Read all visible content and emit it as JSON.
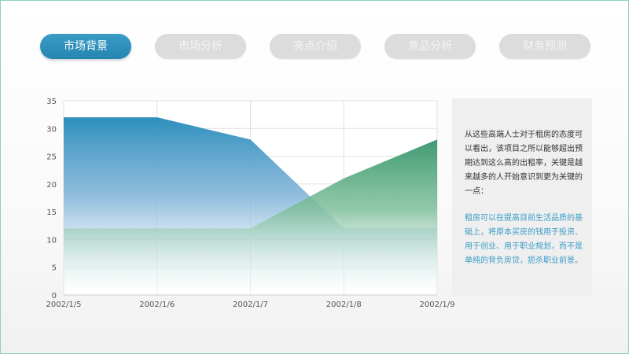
{
  "tabs": [
    {
      "label": "市场背景",
      "active": true
    },
    {
      "label": "市场分析",
      "active": false
    },
    {
      "label": "亮点介绍",
      "active": false
    },
    {
      "label": "竞品分析",
      "active": false
    },
    {
      "label": "财务预测",
      "active": false
    }
  ],
  "panel": {
    "paragraph1": "从这些高端人士对于租房的态度可以看出，该项目之所以能够超出预期达到这么高的出租率，关键是越来越多的人开始意识到更为关键的一点：",
    "paragraph2": "租房可以在提高目前生活品质的基础上，将原本买房的钱用于投资、用于创业、用于职业规划，而不是单纯的背负房贷，扼杀职业前景。"
  },
  "colors": {
    "accent": "#2e8fbd",
    "series1": "#2e8fbd",
    "series2": "#3f9a72",
    "panel_text_highlight": "#3a9cc6"
  },
  "chart_data": {
    "type": "area",
    "x": [
      "2002/1/5",
      "2002/1/6",
      "2002/1/7",
      "2002/1/8",
      "2002/1/9"
    ],
    "series": [
      {
        "values": [
          32,
          32,
          28,
          12,
          12
        ],
        "color": "#2e8fbd"
      },
      {
        "values": [
          12,
          12,
          12,
          21,
          28
        ],
        "color": "#3f9a72"
      }
    ],
    "ylim": [
      0,
      35
    ],
    "yticks": [
      0,
      5,
      10,
      15,
      20,
      25,
      30,
      35
    ],
    "grid": true,
    "legend": "none"
  }
}
